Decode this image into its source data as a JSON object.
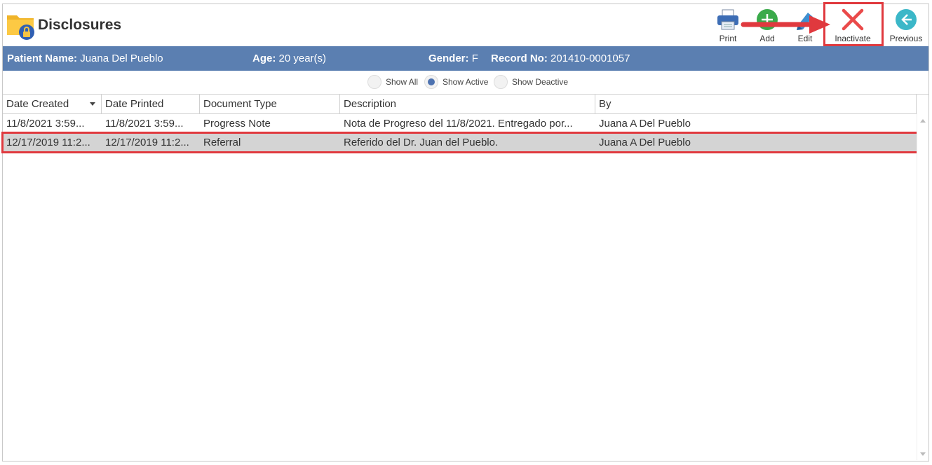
{
  "header": {
    "title": "Disclosures"
  },
  "toolbar": {
    "print": "Print",
    "add": "Add",
    "edit": "Edit",
    "inactivate": "Inactivate",
    "previous": "Previous"
  },
  "patient": {
    "name_label": "Patient Name:",
    "name": "Juana Del Pueblo",
    "age_label": "Age:",
    "age": "20 year(s)",
    "gender_label": "Gender:",
    "gender": "F",
    "record_label": "Record No:",
    "record": "201410-0001057"
  },
  "filters": {
    "show_all": "Show All",
    "show_active": "Show Active",
    "show_deactive": "Show Deactive",
    "selected": "show_active"
  },
  "grid": {
    "columns": [
      "Date Created",
      "Date Printed",
      "Document Type",
      "Description",
      "By"
    ],
    "rows": [
      [
        "11/8/2021 3:59...",
        "11/8/2021 3:59...",
        "Progress Note",
        "Nota de Progreso del 11/8/2021. Entregado por...",
        "Juana A Del Pueblo"
      ],
      [
        "12/17/2019 11:2...",
        "12/17/2019 11:2...",
        "Referral",
        "Referido del Dr. Juan del Pueblo.",
        "Juana A Del Pueblo"
      ]
    ],
    "selected_row": 1
  },
  "colors": {
    "accent": "#5b7fb1",
    "highlight": "#e0393e",
    "add_green": "#3aaa4a",
    "previous_teal": "#3bb7c8"
  }
}
